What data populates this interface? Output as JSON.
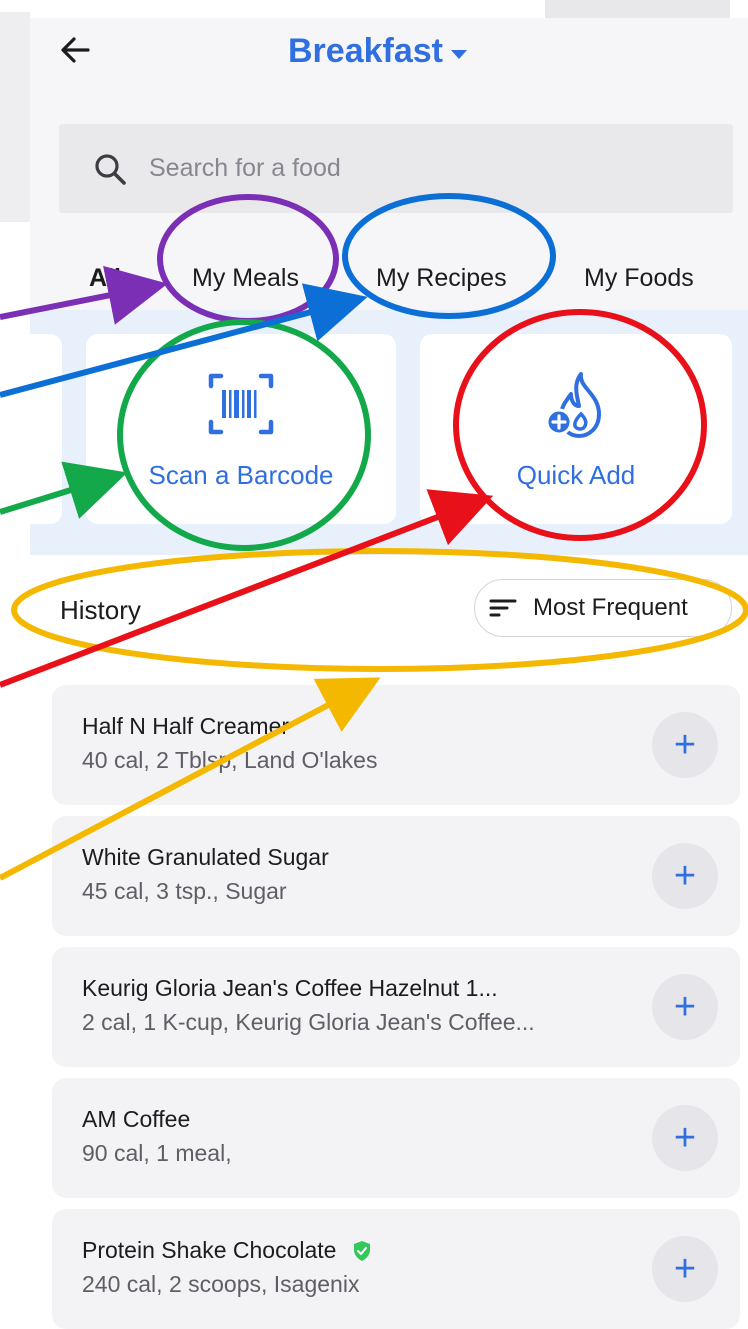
{
  "header": {
    "title": "Breakfast"
  },
  "search": {
    "placeholder": "Search for a food"
  },
  "tabs": [
    {
      "label": "All"
    },
    {
      "label": "My Meals"
    },
    {
      "label": "My Recipes"
    },
    {
      "label": "My Foods"
    }
  ],
  "actions": [
    {
      "label": "Scan a Barcode",
      "icon": "barcode-scan-icon"
    },
    {
      "label": "Quick Add",
      "icon": "flame-plus-icon"
    }
  ],
  "history": {
    "title": "History",
    "sort_label": "Most Frequent",
    "items": [
      {
        "name": "Half N Half Creamer",
        "detail": "40 cal, 2 Tblsp, Land O'lakes",
        "verified": false
      },
      {
        "name": "White Granulated Sugar",
        "detail": "45 cal, 3 tsp., Sugar",
        "verified": false
      },
      {
        "name": "Keurig Gloria Jean's Coffee Hazelnut 1...",
        "detail": "2 cal, 1 K-cup, Keurig Gloria Jean's Coffee...",
        "verified": false
      },
      {
        "name": "AM Coffee",
        "detail": "90 cal, 1 meal,",
        "verified": false
      },
      {
        "name": "Protein Shake Chocolate",
        "detail": "240 cal, 2 scoops, Isagenix",
        "verified": true
      }
    ]
  },
  "colors": {
    "accent": "#2f6fe0",
    "annotation_purple": "#7b2fb5",
    "annotation_blue": "#0b6fd6",
    "annotation_green": "#13a84a",
    "annotation_red": "#e8111a",
    "annotation_yellow": "#f5b800",
    "verified_green": "#34c759"
  }
}
